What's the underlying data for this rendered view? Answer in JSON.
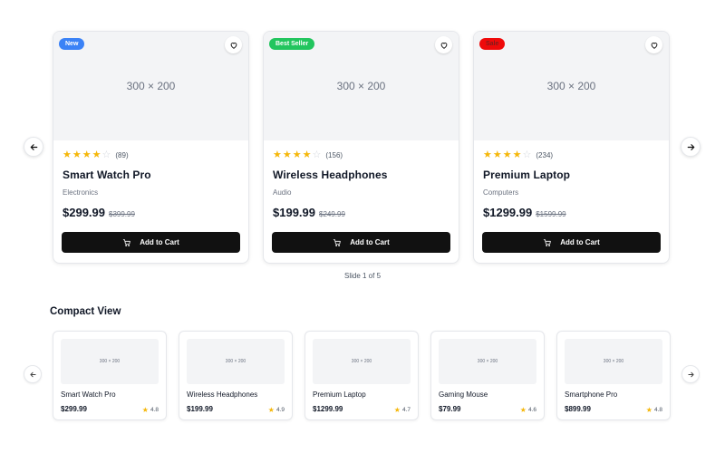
{
  "featured": {
    "products": [
      {
        "image_label": "300 × 200",
        "badge": "New",
        "badge_color": "#3b82f6",
        "rating_stars": 4,
        "reviews": "(89)",
        "name": "Smart Watch Pro",
        "category": "Electronics",
        "price": "$299.99",
        "old_price": "$399.99",
        "cart_label": "Add to Cart"
      },
      {
        "image_label": "300 × 200",
        "badge": "Best Seller",
        "badge_color": "#22c55e",
        "rating_stars": 4,
        "reviews": "(156)",
        "name": "Wireless Headphones",
        "category": "Audio",
        "price": "$199.99",
        "old_price": "$249.99",
        "cart_label": "Add to Cart"
      },
      {
        "image_label": "300 × 200",
        "badge": "Sale",
        "badge_color": "#ef0a0a",
        "rating_stars": 4,
        "reviews": "(234)",
        "name": "Premium Laptop",
        "category": "Computers",
        "price": "$1299.99",
        "old_price": "$1599.99",
        "cart_label": "Add to Cart"
      }
    ],
    "slide_indicator": "Slide 1 of 5"
  },
  "compact": {
    "title": "Compact View",
    "products": [
      {
        "image_label": "300 × 200",
        "name": "Smart Watch Pro",
        "price": "$299.99",
        "rating": "4.8"
      },
      {
        "image_label": "300 × 200",
        "name": "Wireless Headphones",
        "price": "$199.99",
        "rating": "4.9"
      },
      {
        "image_label": "300 × 200",
        "name": "Premium Laptop",
        "price": "$1299.99",
        "rating": "4.7"
      },
      {
        "image_label": "300 × 200",
        "name": "Gaming Mouse",
        "price": "$79.99",
        "rating": "4.6"
      },
      {
        "image_label": "300 × 200",
        "name": "Smartphone Pro",
        "price": "$899.99",
        "rating": "4.8"
      }
    ]
  },
  "icons": {
    "prev": "arrow-left-icon",
    "next": "arrow-right-icon",
    "wishlist": "heart-icon",
    "cart": "shopping-cart-icon",
    "star": "star-icon"
  },
  "colors": {
    "button_bg": "#111111",
    "star": "#f5b70a",
    "image_placeholder": "#f3f4f6"
  }
}
